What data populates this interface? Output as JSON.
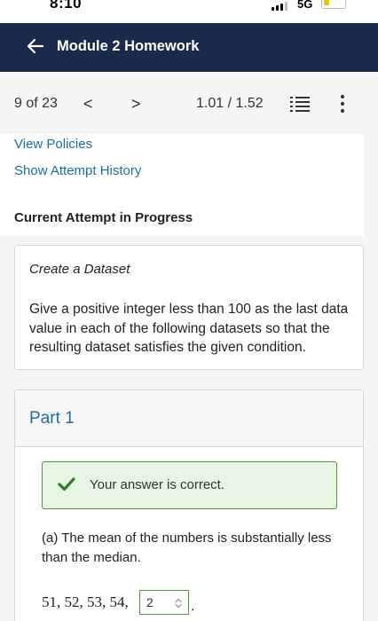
{
  "status_bar": {
    "time": "8:10",
    "network": "5G"
  },
  "header": {
    "title": "Module 2 Homework"
  },
  "toolbar": {
    "question_count": "9 of 23",
    "prev_label": "<",
    "next_label": ">",
    "score": "1.01 / 1.52"
  },
  "links": {
    "view_policies": "View Policies",
    "show_attempt_history": "Show Attempt History"
  },
  "attempt_status": "Current Attempt in Progress",
  "question": {
    "heading": "Create a Dataset",
    "body": "Give a positive integer less than 100 as the last data value in each of the following datasets so that the resulting dataset satisfies the given condition."
  },
  "part": {
    "title": "Part 1",
    "feedback": "Your answer is correct.",
    "prompt": "(a) The mean of the numbers is substantially less than the median.",
    "dataset_prefix": "51, 52, 53, 54,",
    "answer_value": "2",
    "trailing": "."
  },
  "colors": {
    "header_bg": "#1a2a4a",
    "link": "#1a6ea8",
    "correct_bg": "#e8f5e4",
    "correct_border": "#4c9a3a"
  }
}
